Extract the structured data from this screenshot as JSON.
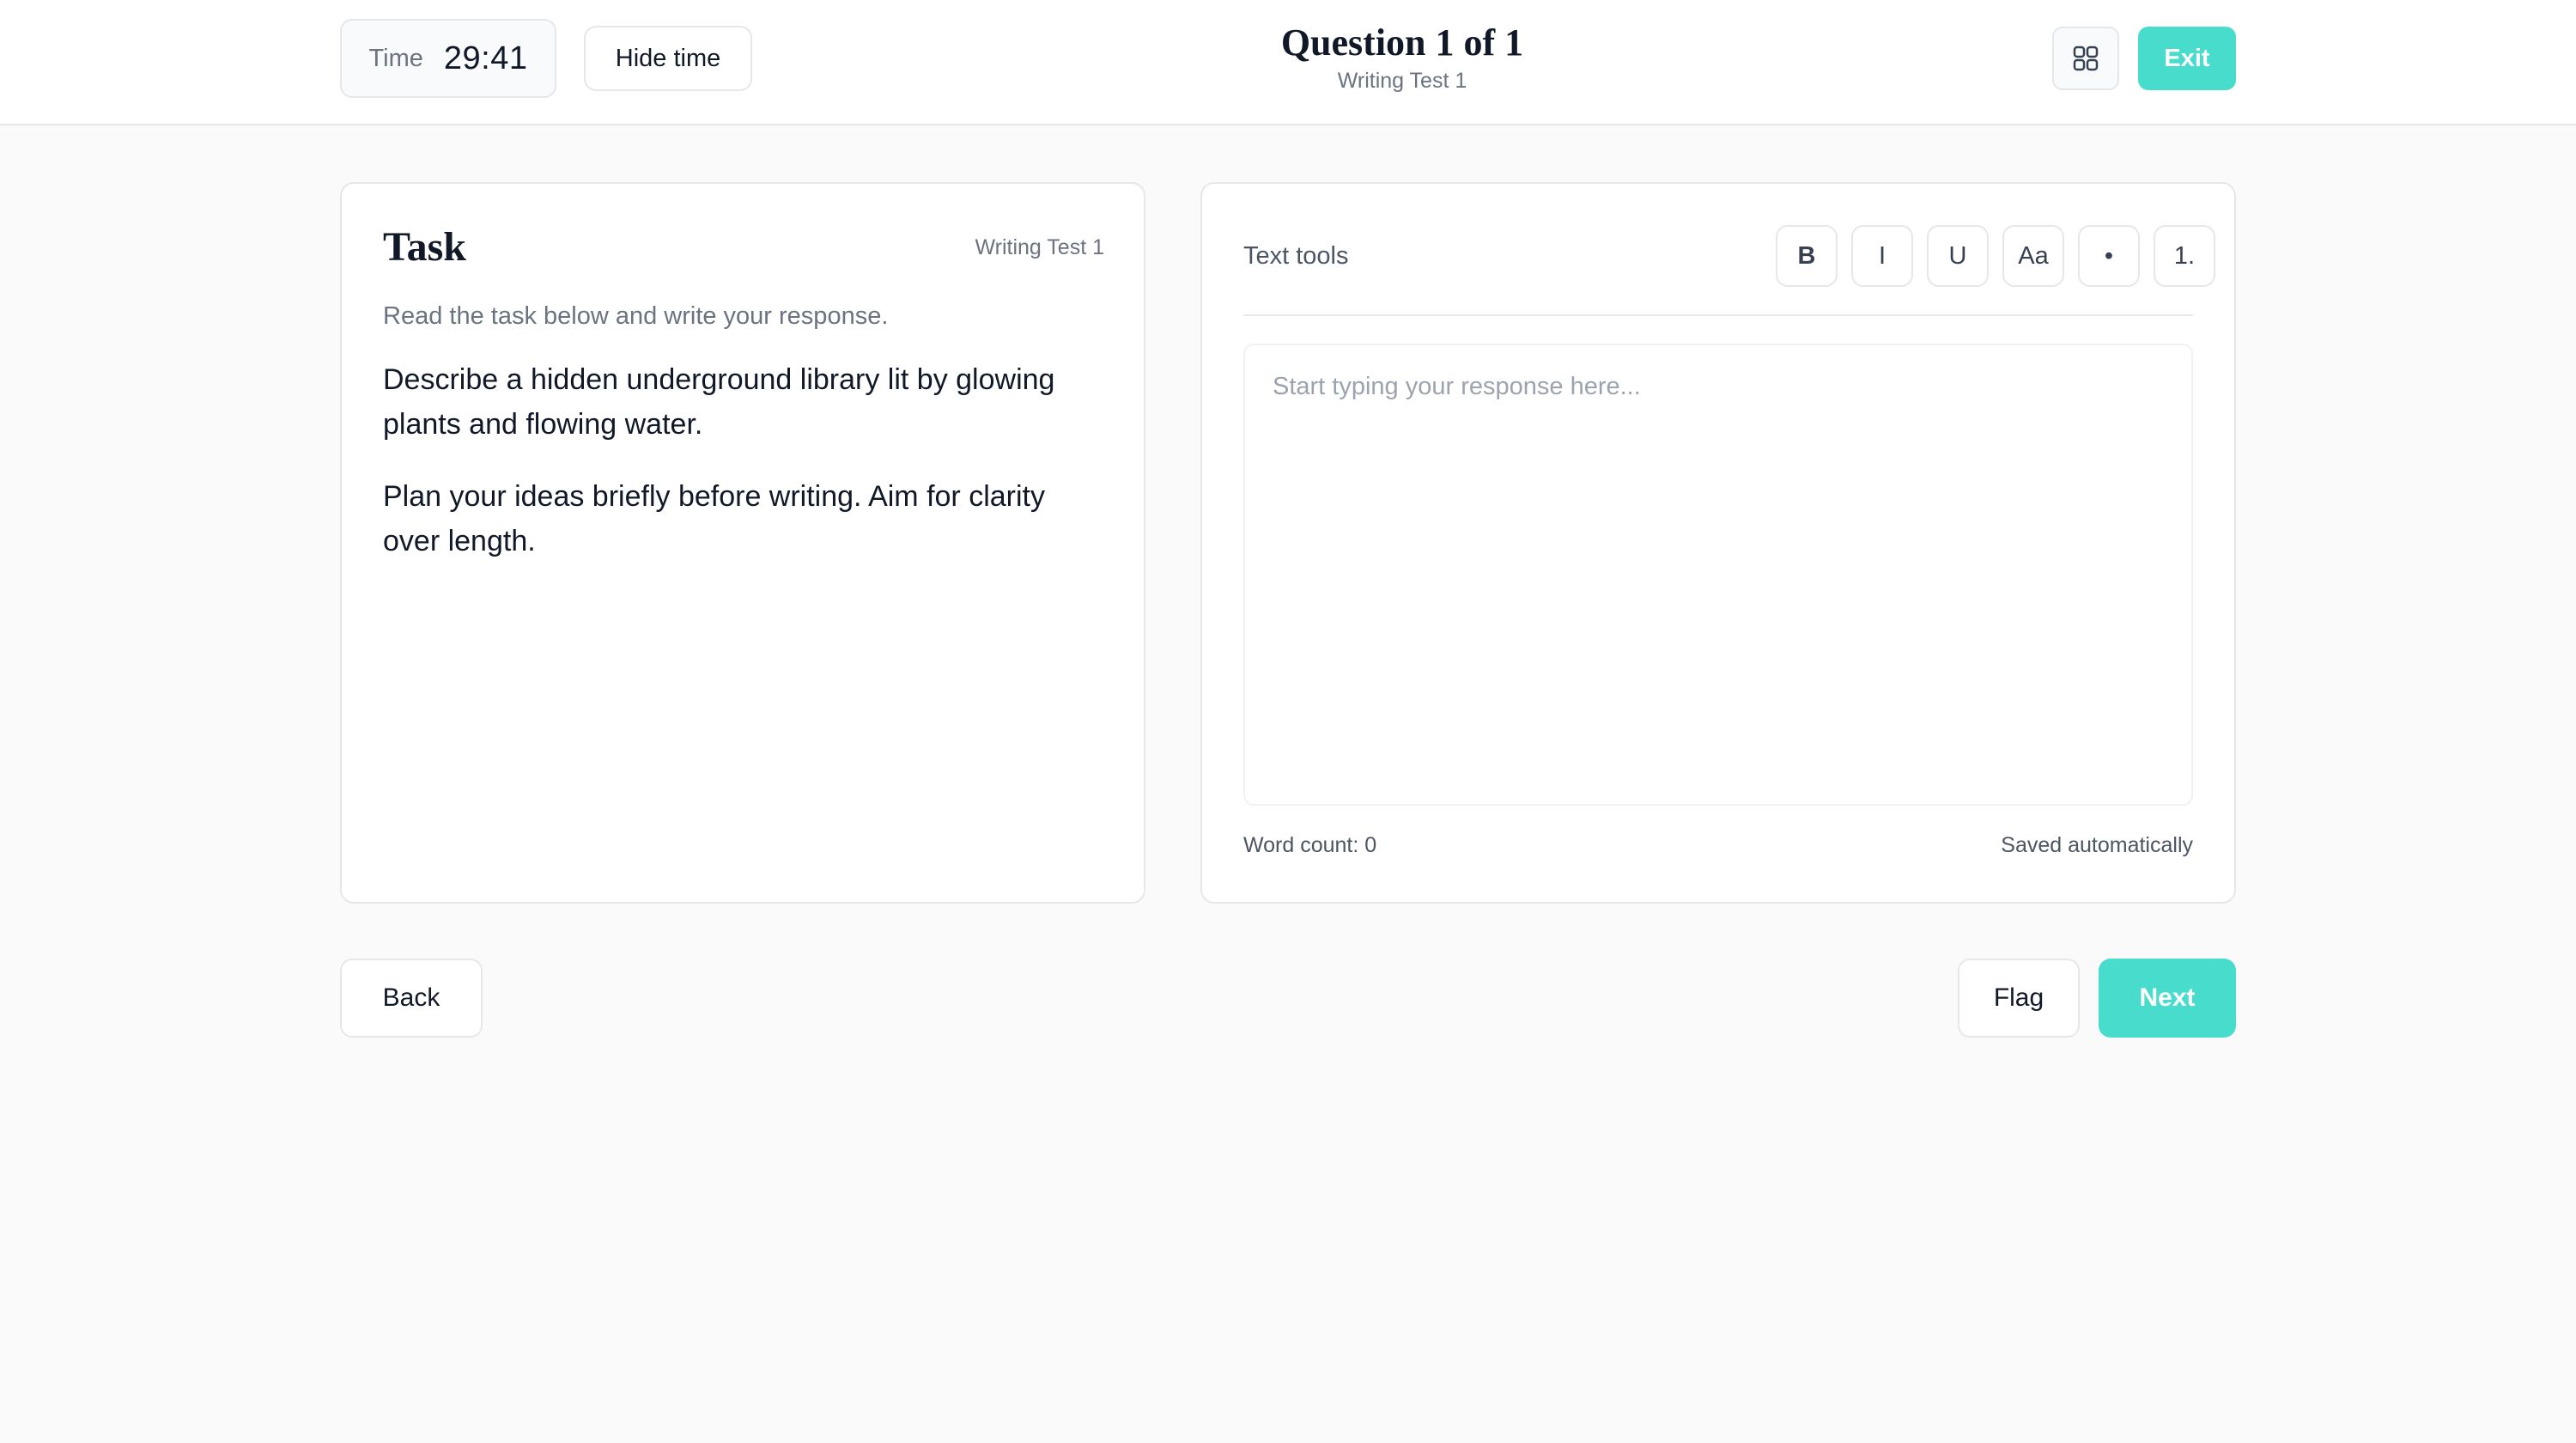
{
  "header": {
    "timer_label": "Time",
    "timer_value": "29:41",
    "hide_time_label": "Hide time",
    "question_title": "Question 1 of 1",
    "test_name": "Writing Test 1",
    "grid_icon": "grid-icon",
    "exit_label": "Exit"
  },
  "task": {
    "title": "Task",
    "tag": "Writing Test 1",
    "instruction": "Read the task below and write your response.",
    "paragraphs": [
      "Describe a hidden underground library lit by glowing plants and flowing water.",
      "Plan your ideas briefly before writing. Aim for clarity over length."
    ]
  },
  "editor": {
    "tools_label": "Text tools",
    "tools": [
      "B",
      "I",
      "U",
      "Aa",
      "•",
      "1."
    ],
    "placeholder": "Start typing your response here...",
    "value": "",
    "word_count": "Word count: 0",
    "saved_status": "Saved automatically"
  },
  "footer": {
    "back_label": "Back",
    "flag_label": "Flag",
    "next_label": "Next"
  },
  "colors": {
    "accent": "#47dccb",
    "background": "#fafafa",
    "border": "#e5e7eb"
  }
}
